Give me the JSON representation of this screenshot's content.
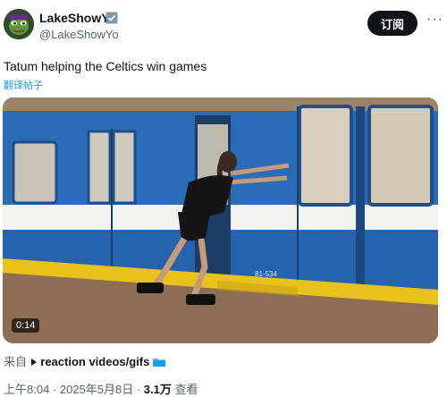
{
  "author": {
    "name": "LakeShowYo",
    "handle": "@LakeShowYo",
    "verified_icon": "verified-badge-icon"
  },
  "header": {
    "subscribe_label": "订阅",
    "more_label": "···"
  },
  "tweet": {
    "text": "Tatum helping the Celtics win games",
    "translate_label": "翻译帖子"
  },
  "media": {
    "duration": "0:14",
    "train_number": "81-534"
  },
  "source": {
    "prefix": "来自",
    "community": "reaction videos/gifs"
  },
  "meta": {
    "time": "上午8:04 · 2025年5月8日 · ",
    "views_count": "3.1万",
    "views_label": " 查看"
  },
  "colors": {
    "accent": "#1d9bf0",
    "train_blue": "#2a6cb8",
    "platform_yellow": "#e8c21a"
  }
}
